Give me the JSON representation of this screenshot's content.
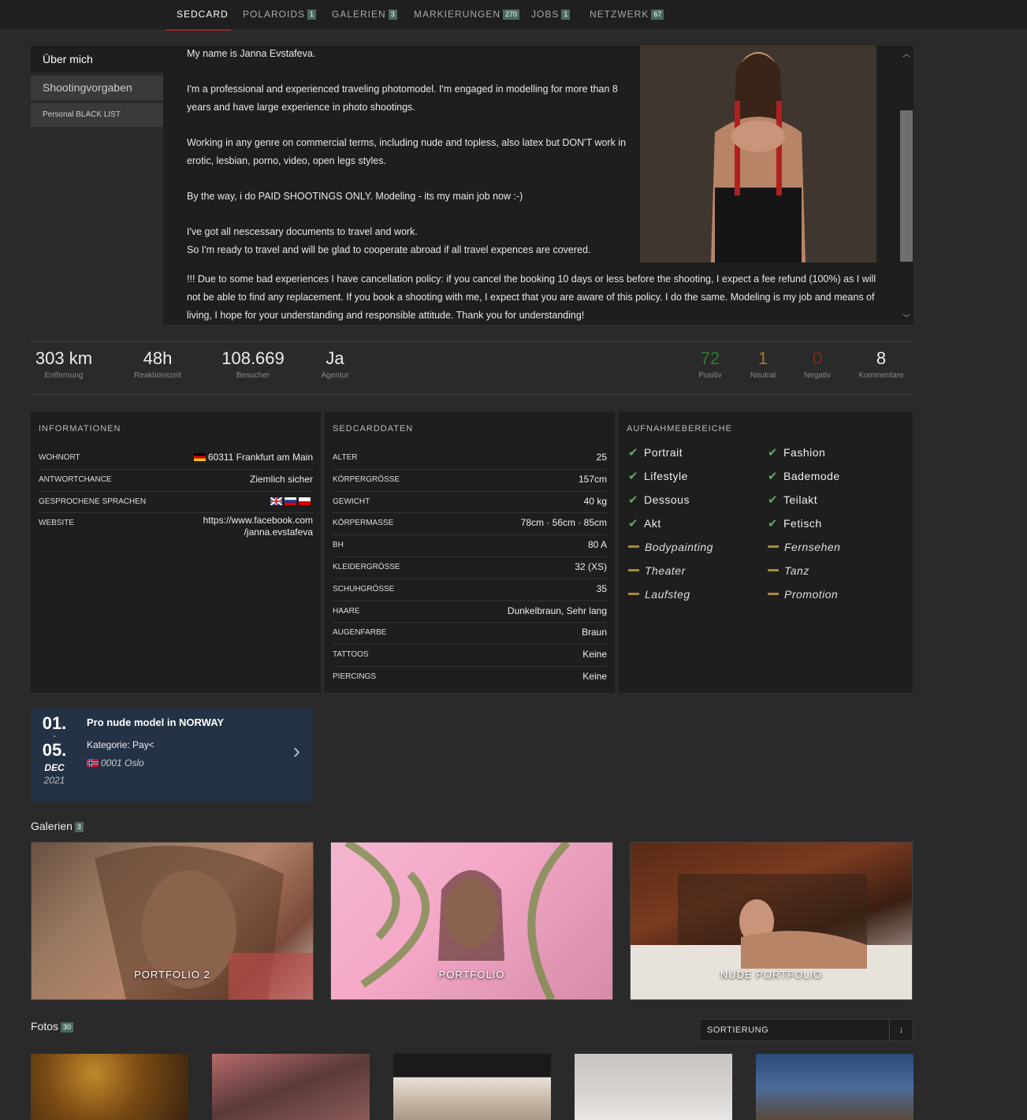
{
  "nav": {
    "tabs": [
      {
        "label": "SEDCARD",
        "count": ""
      },
      {
        "label": "POLAROIDS",
        "count": "1"
      },
      {
        "label": "GALERIEN",
        "count": "3"
      },
      {
        "label": "MARKIERUNGEN",
        "count": "270"
      },
      {
        "label": "JOBS",
        "count": "1"
      },
      {
        "label": "NETZWERK",
        "count": "67"
      }
    ]
  },
  "sidebar": {
    "items": [
      "Über mich",
      "Shootingvorgaben",
      "Personal BLACK LIST"
    ]
  },
  "about": {
    "p1": "My name is Janna Evstafeva.",
    "p2": "I'm a professional and experienced traveling photomodel. I'm engaged in modelling for more than 8 years and have large experience in photo shootings.",
    "p3": "Working in any genre on commercial terms, including nude and topless, also latex but DON'T work in erotic, lesbian, porno, video, open legs styles.",
    "p4": "By the way, i do PAID SHOOTINGS ONLY. Modeling - its my main job now :-)",
    "p5a": "I've got all nescessary documents to travel and work.",
    "p5b": "So I'm ready to travel and will be glad to cooperate abroad if all travel expences are covered.",
    "p6": "!!! Due to some bad experiences I have cancellation policy: if you cancel the booking 10 days or less before the shooting, I expect a fee refund (100%) as I will not be able to find any replacement. If you book a shooting with me, I expect that you are aware of this policy. I do the same. Modeling is my job and means of living, I hope for your understanding and responsible attitude. Thank you for understanding!"
  },
  "stats": {
    "distance": {
      "value": "303 km",
      "label": "Entfernung"
    },
    "response": {
      "value": "48h",
      "label": "Reaktionszeit"
    },
    "visitors": {
      "value": "108.669",
      "label": "Besucher"
    },
    "agency": {
      "value": "Ja",
      "label": "Agentur"
    },
    "positive": {
      "value": "72",
      "label": "Positiv",
      "color": "#2f7a2f"
    },
    "neutral": {
      "value": "1",
      "label": "Neutral",
      "color": "#a07a2a"
    },
    "negative": {
      "value": "0",
      "label": "Negativ",
      "color": "#7a2a1a"
    },
    "comments": {
      "value": "8",
      "label": "Kommentare"
    }
  },
  "info": {
    "title": "INFORMATIONEN",
    "rows": [
      {
        "k": "WOHNORT",
        "v": "60311 Frankfurt am Main"
      },
      {
        "k": "ANTWORTCHANCE",
        "v": "Ziemlich sicher"
      },
      {
        "k": "GESPROCHENE SPRACHEN",
        "v": ""
      },
      {
        "k": "WEBSITE",
        "v1": "https://www.facebook.com",
        "v2": "/janna.evstafeva"
      }
    ]
  },
  "sedcard": {
    "title": "SEDCARDDATEN",
    "rows": [
      {
        "k": "ALTER",
        "v": "25"
      },
      {
        "k": "KÖRPERGRÖSSE",
        "v": "157cm"
      },
      {
        "k": "GEWICHT",
        "v": "40 kg"
      },
      {
        "k": "KÖRPERMASSE",
        "v": "78cm · 56cm · 85cm"
      },
      {
        "k": "BH",
        "v": "80 A"
      },
      {
        "k": "KLEIDERGRÖSSE",
        "v": "32 (XS)"
      },
      {
        "k": "SCHUHGRÖSSE",
        "v": "35"
      },
      {
        "k": "HAARE",
        "v": "Dunkelbraun, Sehr lang"
      },
      {
        "k": "AUGENFARBE",
        "v": "Braun"
      },
      {
        "k": "TATTOOS",
        "v": "Keine"
      },
      {
        "k": "PIERCINGS",
        "v": "Keine"
      }
    ]
  },
  "areas": {
    "title": "AUFNAHMEBEREICHE",
    "items": [
      {
        "label": "Portrait",
        "status": "yes"
      },
      {
        "label": "Fashion",
        "status": "yes"
      },
      {
        "label": "Lifestyle",
        "status": "yes"
      },
      {
        "label": "Bademode",
        "status": "yes"
      },
      {
        "label": "Dessous",
        "status": "yes"
      },
      {
        "label": "Teilakt",
        "status": "yes"
      },
      {
        "label": "Akt",
        "status": "yes"
      },
      {
        "label": "Fetisch",
        "status": "yes"
      },
      {
        "label": "Bodypainting",
        "status": "partial"
      },
      {
        "label": "Fernsehen",
        "status": "partial"
      },
      {
        "label": "Theater",
        "status": "partial"
      },
      {
        "label": "Tanz",
        "status": "partial"
      },
      {
        "label": "Laufsteg",
        "status": "partial"
      },
      {
        "label": "Promotion",
        "status": "partial"
      }
    ]
  },
  "job": {
    "day_start": "01.",
    "separator": "-",
    "day_end": "05.",
    "month": "DEC",
    "year": "2021",
    "title": "Pro nude model in NORWAY",
    "category": "Kategorie: Pay<",
    "location": "0001 Oslo"
  },
  "galleries": {
    "title": "Galerien",
    "count": "3",
    "items": [
      "PORTFOLIO 2",
      "PORTFOLIO",
      "NUDE PORTFOLIO"
    ]
  },
  "photos": {
    "title": "Fotos",
    "count": "30",
    "sort_label": "SORTIERUNG",
    "sort_icon": "↓"
  },
  "colors": {
    "accent": "#8b2a22",
    "badge": "#4a6b5d",
    "check": "#5fa85f",
    "partial": "#a88a3a",
    "job_bg": "#243246"
  }
}
